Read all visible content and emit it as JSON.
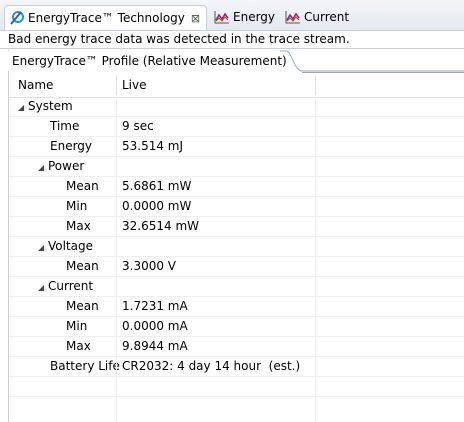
{
  "tabs": [
    {
      "label": "EnergyTrace™ Technology",
      "icon": "energytrace-icon",
      "active": true
    },
    {
      "label": "Energy",
      "icon": "energy-graph-icon",
      "active": false
    },
    {
      "label": "Current",
      "icon": "current-graph-icon",
      "active": false
    }
  ],
  "status_message": "Bad energy trace data was detected in the trace stream.",
  "profile_tab": {
    "label": "EnergyTrace™ Profile (Relative Measurement)"
  },
  "table": {
    "columns": [
      "Name",
      "Live"
    ],
    "rows": [
      {
        "name": "System",
        "value": "",
        "expanded": true
      },
      {
        "name": "Time",
        "value": "9 sec"
      },
      {
        "name": "Energy",
        "value": "53.514 mJ"
      },
      {
        "name": "Power",
        "value": "",
        "expanded": true
      },
      {
        "name": "Mean",
        "value": "5.6861 mW"
      },
      {
        "name": "Min",
        "value": "0.0000 mW"
      },
      {
        "name": "Max",
        "value": "32.6514 mW"
      },
      {
        "name": "Voltage",
        "value": "",
        "expanded": true
      },
      {
        "name": "Mean",
        "value": "3.3000 V"
      },
      {
        "name": "Current",
        "value": "",
        "expanded": true
      },
      {
        "name": "Mean",
        "value": "1.7231 mA"
      },
      {
        "name": "Min",
        "value": "0.0000 mA"
      },
      {
        "name": "Max",
        "value": "9.8944 mA"
      },
      {
        "name": "Battery Life",
        "value": "CR2032: 4 day 14 hour  (est.)"
      }
    ]
  },
  "colors": {
    "accent": "#3a6fb0",
    "graph_icon": "#7a2a6a"
  }
}
